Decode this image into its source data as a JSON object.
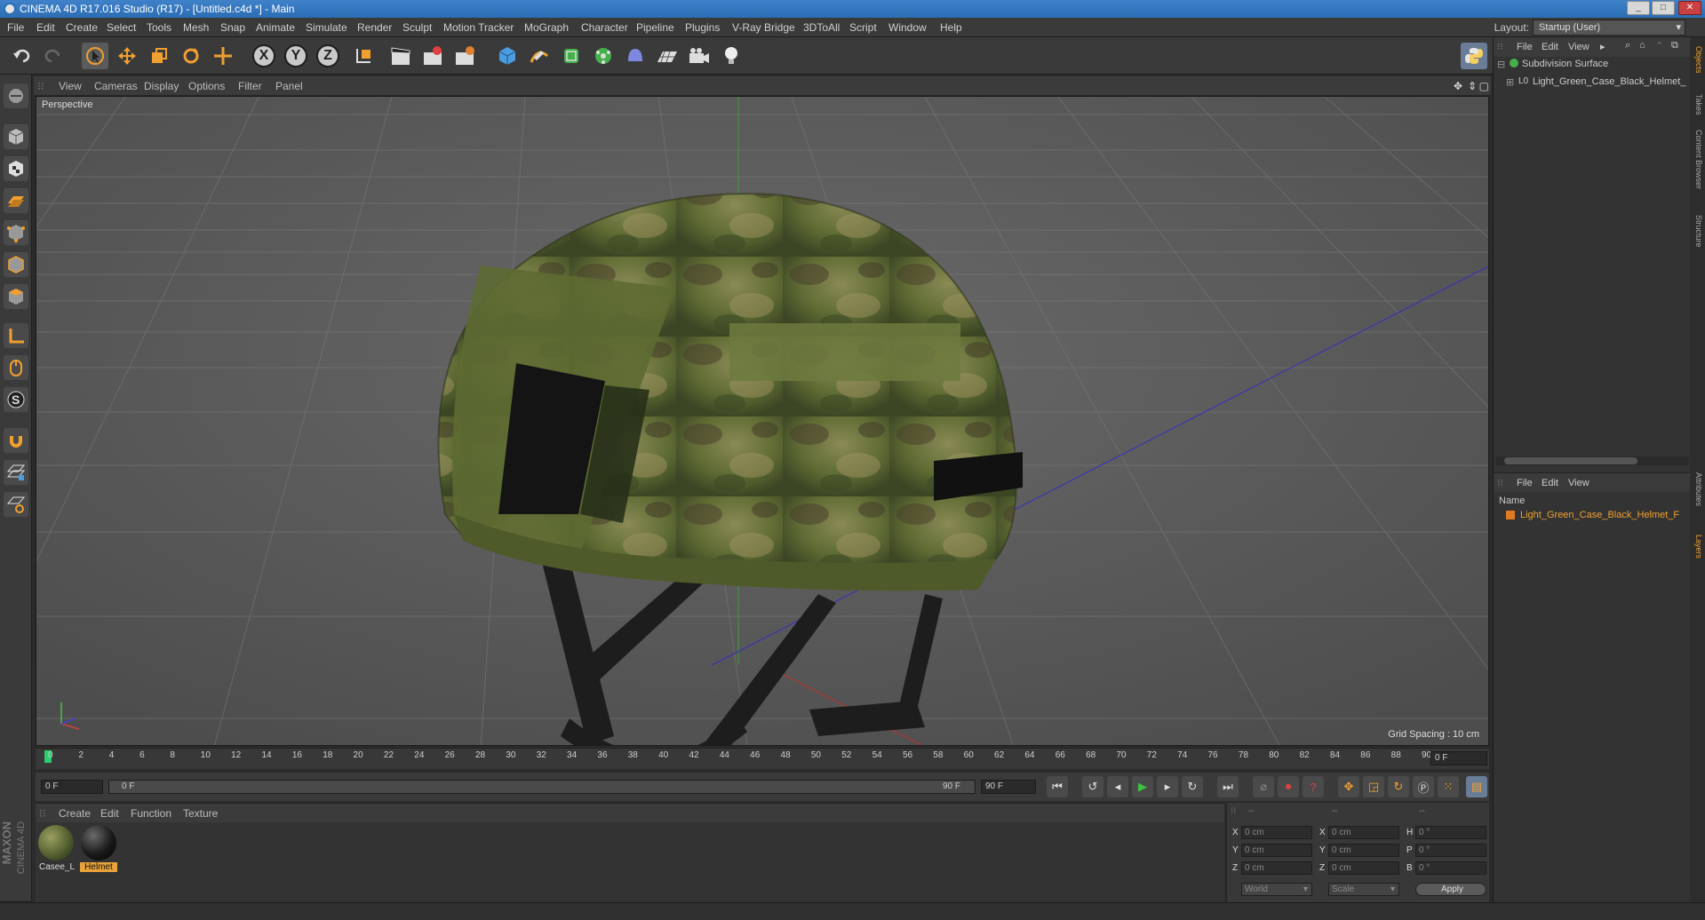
{
  "window": {
    "title": "CINEMA 4D R17.016 Studio (R17) - [Untitled.c4d *] - Main",
    "minimize": "_",
    "maximize": "□",
    "close": "✕"
  },
  "menu": [
    "File",
    "Edit",
    "Create",
    "Select",
    "Tools",
    "Mesh",
    "Snap",
    "Animate",
    "Simulate",
    "Render",
    "Sculpt",
    "Motion Tracker",
    "MoGraph",
    "Character",
    "Pipeline",
    "Plugins",
    "V-Ray Bridge",
    "3DToAll",
    "Script",
    "Window",
    "Help"
  ],
  "layout": {
    "label": "Layout:",
    "value": "Startup (User)"
  },
  "toolbar": {
    "x_label": "X",
    "y_label": "Y",
    "z_label": "Z"
  },
  "viewport": {
    "menu": [
      "View",
      "Cameras",
      "Display",
      "Options",
      "Filter",
      "Panel"
    ],
    "label": "Perspective",
    "grid_spacing": "Grid Spacing : 10 cm"
  },
  "timeline": {
    "ticks": [
      "0",
      "2",
      "4",
      "6",
      "8",
      "10",
      "12",
      "14",
      "16",
      "18",
      "20",
      "22",
      "24",
      "26",
      "28",
      "30",
      "32",
      "34",
      "36",
      "38",
      "40",
      "42",
      "44",
      "46",
      "48",
      "50",
      "52",
      "54",
      "56",
      "58",
      "60",
      "62",
      "64",
      "66",
      "68",
      "70",
      "72",
      "74",
      "76",
      "78",
      "80",
      "82",
      "84",
      "86",
      "88",
      "90"
    ],
    "current_frame": "0 F",
    "start_field": "0 F",
    "range_start": "0 F",
    "range_end": "90 F",
    "end_field": "90 F"
  },
  "materials": {
    "menu": [
      "Create",
      "Edit",
      "Function",
      "Texture"
    ],
    "items": [
      {
        "label": "Casee_L",
        "selected": false
      },
      {
        "label": "Helmet",
        "selected": true
      }
    ]
  },
  "coords": {
    "headers": [
      "--",
      "--",
      "--"
    ],
    "rows": [
      {
        "l1": "X",
        "v1": "0 cm",
        "l2": "X",
        "v2": "0 cm",
        "l3": "H",
        "v3": "0 °"
      },
      {
        "l1": "Y",
        "v1": "0 cm",
        "l2": "Y",
        "v2": "0 cm",
        "l3": "P",
        "v3": "0 °"
      },
      {
        "l1": "Z",
        "v1": "0 cm",
        "l2": "Z",
        "v2": "0 cm",
        "l3": "B",
        "v3": "0 °"
      }
    ],
    "mode": "World",
    "type": "Scale",
    "apply": "Apply"
  },
  "objects_panel": {
    "menu": [
      "File",
      "Edit",
      "View"
    ],
    "tree": [
      {
        "name": "Subdivision Surface"
      },
      {
        "name": "Light_Green_Case_Black_Helmet_"
      }
    ]
  },
  "layers_panel": {
    "menu": [
      "File",
      "Edit",
      "View"
    ],
    "column": "Name",
    "items": [
      {
        "name": "Light_Green_Case_Black_Helmet_F"
      }
    ]
  },
  "right_tabs": [
    "Objects",
    "Takes",
    "Content Browser",
    "Structure",
    "Attributes",
    "Layers"
  ],
  "brand": {
    "line1": "MAXON",
    "line2": "CINEMA 4D"
  },
  "colors": {
    "accent_orange": "#f0a030",
    "viewport_bg": "#5e5e5e",
    "selection": "#e8a23a"
  }
}
